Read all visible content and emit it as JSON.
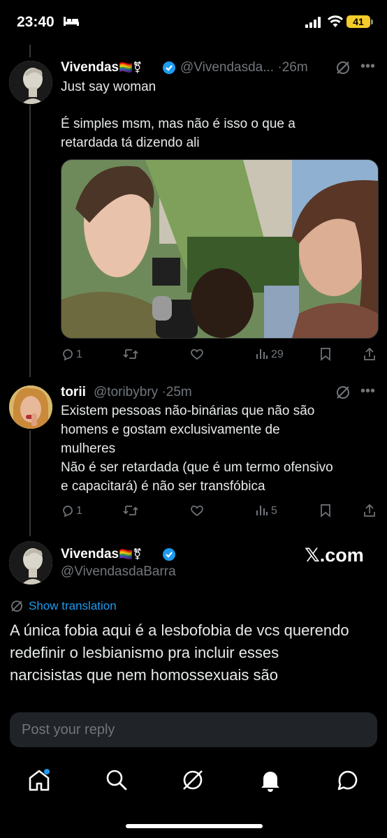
{
  "status_bar": {
    "time": "23:40",
    "battery": "41"
  },
  "post1": {
    "display_name": "Vivendas",
    "name_emoji": "🏳️‍🌈⚧",
    "handle": "@Vivendasda...",
    "separator": "·",
    "time": "26m",
    "text_line1": "Just say woman",
    "text_line2": "É simples msm, mas não é isso o que a",
    "text_line3": "retardada tá dizendo ali",
    "replies": "1",
    "views": "29"
  },
  "post2": {
    "display_name": "torii",
    "handle": "@toribybry",
    "separator": "·",
    "time": "25m",
    "text_line1": "Existem pessoas não-binárias que não são",
    "text_line2": "homens e gostam exclusivamente de",
    "text_line3": "mulheres",
    "text_line4": "Não é ser retardada (que é um termo ofensivo",
    "text_line5": "e capacitará) é não ser transfóbica",
    "replies": "1",
    "views": "5"
  },
  "post3": {
    "display_name": "Vivendas",
    "name_emoji": "🏳️‍🌈⚧",
    "handle": "@VivendasdaBarra",
    "brand": "𝕏.com",
    "show_translation": "Show translation",
    "text_line1": "A única fobia aqui é a lesbofobia de vcs querendo",
    "text_line2": "redefinir o lesbianismo pra incluir esses",
    "text_line3": "narcisistas que nem homossexuais são"
  },
  "reply": {
    "placeholder": "Post your reply"
  },
  "colors": {
    "background": "#000000",
    "accent": "#1d9bf0",
    "muted": "#71767b",
    "text": "#e7e9ea"
  }
}
